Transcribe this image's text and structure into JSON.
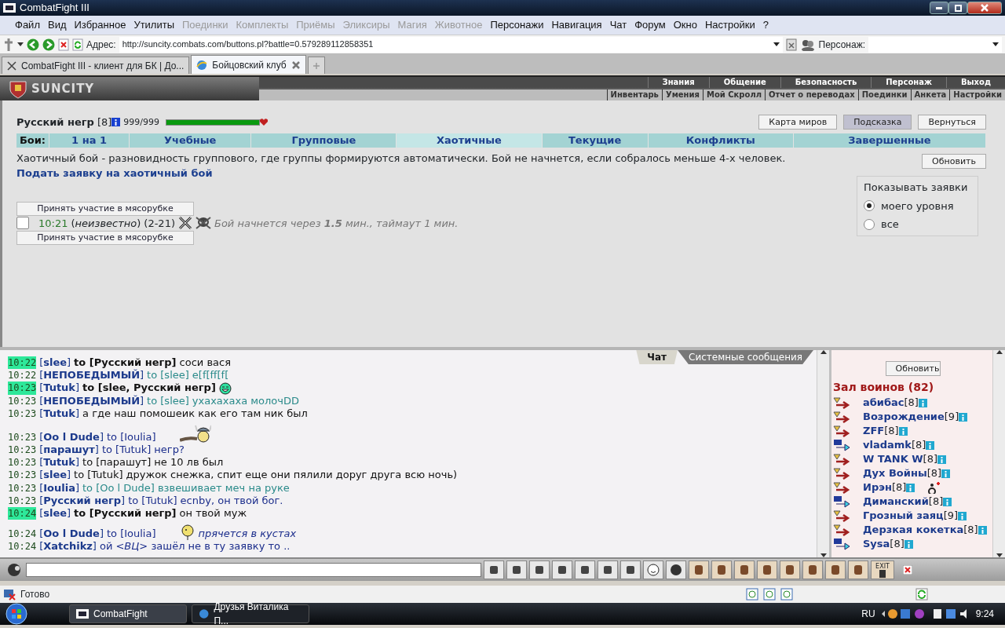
{
  "window": {
    "title": "CombatFight III"
  },
  "menu": [
    {
      "label": "Файл",
      "disabled": false
    },
    {
      "label": "Вид",
      "disabled": false
    },
    {
      "label": "Избранное",
      "disabled": false
    },
    {
      "label": "Утилиты",
      "disabled": false
    },
    {
      "label": "Поединки",
      "disabled": true
    },
    {
      "label": "Комплекты",
      "disabled": true
    },
    {
      "label": "Приёмы",
      "disabled": true
    },
    {
      "label": "Эликсиры",
      "disabled": true
    },
    {
      "label": "Магия",
      "disabled": true
    },
    {
      "label": "Животное",
      "disabled": true
    },
    {
      "label": "Персонажи",
      "disabled": false
    },
    {
      "label": "Навигация",
      "disabled": false
    },
    {
      "label": "Чат",
      "disabled": false
    },
    {
      "label": "Форум",
      "disabled": false
    },
    {
      "label": "Окно",
      "disabled": false
    },
    {
      "label": "Настройки",
      "disabled": false
    },
    {
      "label": "?",
      "disabled": false
    }
  ],
  "address_bar": {
    "label": "Адрес:",
    "url": "http://suncity.combats.com/buttons.pl?battle=0.579289112858351",
    "character_label": "Персонаж:"
  },
  "tabs": [
    {
      "label": "CombatFight III - клиент для БК | До...",
      "selected": false
    },
    {
      "label": "Бойцовский клуб",
      "selected": true
    }
  ],
  "site_nav": {
    "logo": "SUNCITY",
    "top": [
      "Знания",
      "Общение",
      "Безопасность",
      "Персонаж",
      "Выход"
    ],
    "bottom": [
      "Инвентарь",
      "Умения",
      "Мой Скролл",
      "Отчет о переводах",
      "Поединки",
      "Анкета",
      "Настройки"
    ]
  },
  "player": {
    "name": "Русский негр",
    "rank": "[8]",
    "hp": "999/999",
    "hp_bar": {
      "level": 1
    }
  },
  "top_buttons": [
    {
      "label": "Карта миров",
      "pressed": false
    },
    {
      "label": "Подсказка",
      "pressed": true
    },
    {
      "label": "Вернуться",
      "pressed": false
    }
  ],
  "battle_tabs": {
    "label": "Бои:",
    "items": [
      {
        "label": "1 на 1",
        "selected": false
      },
      {
        "label": "Учебные",
        "selected": false
      },
      {
        "label": "Групповые",
        "selected": false
      },
      {
        "label": "Хаотичные",
        "selected": true
      },
      {
        "label": "Текущие",
        "selected": false
      },
      {
        "label": "Конфликты",
        "selected": false
      },
      {
        "label": "Завершенные",
        "selected": false
      }
    ]
  },
  "description": "Хаотичный бой - разновидность группового, где группы формируются автоматически. Бой не начнется, если собралось меньше 4-х человек.",
  "apply_link": "Подать заявку на хаотичный бой",
  "refresh_button": "Обновить",
  "filter": {
    "legend": "Показывать заявки",
    "options": [
      {
        "label": "моего уровня",
        "selected": true
      },
      {
        "label": "все",
        "selected": false
      }
    ]
  },
  "requests": [
    {
      "join_buttons": [
        "Принять участие в мясорубке",
        "Принять участие в мясорубке"
      ],
      "selected": false,
      "time": "10:21",
      "team": "(*неизвестно*)",
      "range": "(2-21)",
      "status": "Бой начнется через **1.5** мин., таймаут 1 мин."
    }
  ],
  "chat": {
    "tabs": [
      {
        "label": "Чат",
        "selected": true
      },
      {
        "label": "Системные сообщения",
        "selected": false
      }
    ],
    "messages": [
      {
        "time": "10:22",
        "highlight": true,
        "from": "[**slee**]",
        "to": "**to [Русский негр]**",
        "text": "соси вася",
        "kind": "plain",
        "color": "#111111"
      },
      {
        "time": "10:22",
        "highlight": false,
        "from": "[**НЕПОБЕДЫМЫЙ**]",
        "to": "to [slee]",
        "text": "e[f[ff[f[",
        "kind": "plain",
        "color": "#2a8a8a"
      },
      {
        "time": "10:23",
        "highlight": true,
        "from": "[**Tutuk**]",
        "to": "**to [slee, Русский негр]**",
        "kind": "grin",
        "color": "#111111"
      },
      {
        "time": "10:23",
        "highlight": false,
        "from": "[**НЕПОБЕДЫМЫЙ**]",
        "to": "to [slee]",
        "text": "ухахахаха молочDD",
        "kind": "plain",
        "color": "#2a8a8a"
      },
      {
        "time": "10:23",
        "highlight": false,
        "from": "[**Tutuk**]",
        "text": "а где наш помошеик как его там ник был",
        "kind": "plain",
        "color": "#111111"
      },
      {
        "time": "10:23",
        "highlight": false,
        "from": "[**Oo l Dude**]",
        "to": "to [Ioulia]",
        "kind": "viking",
        "color": "#1c2e8c"
      },
      {
        "time": "10:23",
        "highlight": false,
        "from": "[**парашут**]",
        "to": "to [Tutuk]",
        "text": "негр?",
        "kind": "plain",
        "color": "#1c2e8c"
      },
      {
        "time": "10:23",
        "highlight": false,
        "from": "[**Tutuk**]",
        "to": "to [парашут]",
        "text": "не 10 лв был",
        "kind": "plain",
        "color": "#111111"
      },
      {
        "time": "10:23",
        "highlight": false,
        "from": "[**slee**]",
        "to": "to [Tutuk]",
        "text": "дружок снежка, спит еще они пялили доруг друга всю ночь)",
        "kind": "plain",
        "color": "#111111"
      },
      {
        "time": "10:23",
        "highlight": false,
        "from": "[**Ioulia**]",
        "to": "to [Oo l Dude]",
        "text": "взвешивает меч на руке",
        "kind": "plain",
        "color": "#2a8a8a"
      },
      {
        "time": "10:23",
        "highlight": false,
        "from": "[**Русский негр**]",
        "to": "to [Tutuk]",
        "text": "ecnby, он твой бог.",
        "kind": "plain",
        "color": "#1c2e8c"
      },
      {
        "time": "10:24",
        "highlight": true,
        "from": "[**slee**]",
        "to": "**to [Русский негр]**",
        "text": "он твой муж",
        "kind": "plain",
        "color": "#111111"
      },
      {
        "time": "10:24",
        "highlight": false,
        "from": "[**Oo l Dude**]",
        "to": "to [Ioulia]",
        "text": "*прячется в кустах*",
        "kind": "hide",
        "color": "#1c2e8c"
      },
      {
        "time": "10:24",
        "highlight": false,
        "from": "[**Xatchikz**]",
        "text": "ой *<ВЦ>* зашёл не в ту заявку то ..",
        "kind": "plain",
        "color": "#1c2e8c"
      }
    ]
  },
  "users": {
    "refresh_button": "Обновить",
    "title": "Зал воинов (82)",
    "items": [
      {
        "name": "абибас",
        "rank": "[8]",
        "kind": "fight",
        "injured": false
      },
      {
        "name": "Возрождение",
        "rank": "[9]",
        "kind": "fight",
        "injured": false
      },
      {
        "name": "ZFF",
        "rank": "[8]",
        "kind": "fight",
        "injured": false
      },
      {
        "name": "vladamk",
        "rank": "[8]",
        "kind": "mail",
        "injured": false
      },
      {
        "name": "W TANK W",
        "rank": "[8]",
        "kind": "fight",
        "injured": false
      },
      {
        "name": "Дух Войны",
        "rank": "[8]",
        "kind": "fight",
        "injured": false
      },
      {
        "name": "Ирэн",
        "rank": "[8]",
        "kind": "fight",
        "injured": true
      },
      {
        "name": "Диманский",
        "rank": "[8]",
        "kind": "mail",
        "injured": false
      },
      {
        "name": "Грозный заяц",
        "rank": "[9]",
        "kind": "fight",
        "injured": false
      },
      {
        "name": "Дерзкая кокетка",
        "rank": "[8]",
        "kind": "fight",
        "injured": false
      },
      {
        "name": "Sysa",
        "rank": "[8]",
        "kind": "mail",
        "injured": false
      }
    ]
  },
  "chat_toolbar": {
    "exit_label": "EXIT"
  },
  "status_bar": {
    "text": "Готово"
  },
  "taskbar": {
    "items": [
      {
        "label": "CombatFight",
        "selected": true
      },
      {
        "label": "Друзья Виталика П...",
        "selected": false
      }
    ],
    "language": "RU",
    "clock": "9:24"
  }
}
